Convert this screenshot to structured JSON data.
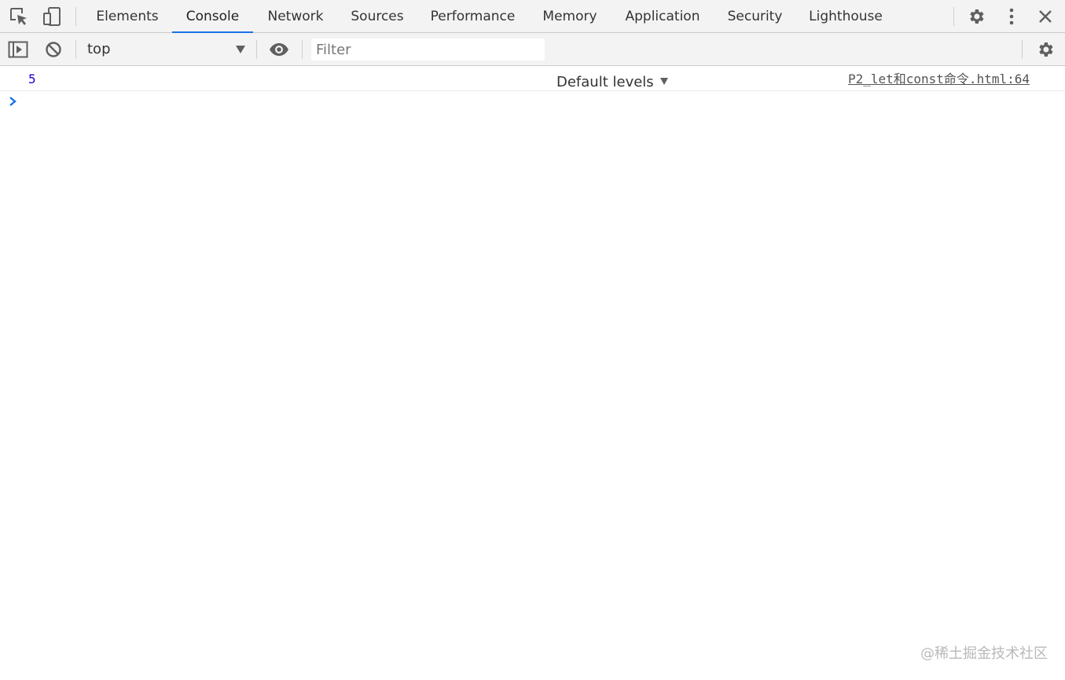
{
  "tabs": [
    {
      "label": "Elements",
      "active": false
    },
    {
      "label": "Console",
      "active": true
    },
    {
      "label": "Network",
      "active": false
    },
    {
      "label": "Sources",
      "active": false
    },
    {
      "label": "Performance",
      "active": false
    },
    {
      "label": "Memory",
      "active": false
    },
    {
      "label": "Application",
      "active": false
    },
    {
      "label": "Security",
      "active": false
    },
    {
      "label": "Lighthouse",
      "active": false
    }
  ],
  "icons": {
    "inspect": "inspect-element-icon",
    "device": "device-toolbar-icon",
    "settings": "gear-icon",
    "menu": "kebab-menu-icon",
    "close": "close-icon",
    "sidebar": "sidebar-toggle-icon",
    "clear": "clear-console-icon",
    "live_expression": "eye-icon",
    "console_settings": "gear-icon",
    "prompt": "chevron-right-icon"
  },
  "toolbar": {
    "context": "top",
    "filter_value": "",
    "filter_placeholder": "Filter",
    "levels_label": "Default levels"
  },
  "console": {
    "messages": [
      {
        "value": "5",
        "source": "P2_let和const命令.html:64"
      }
    ]
  },
  "watermark": "@稀土掘金技术社区",
  "colors": {
    "accent": "#1a73e8",
    "number": "#1c00cf",
    "toolbar_bg": "#f3f3f3"
  }
}
